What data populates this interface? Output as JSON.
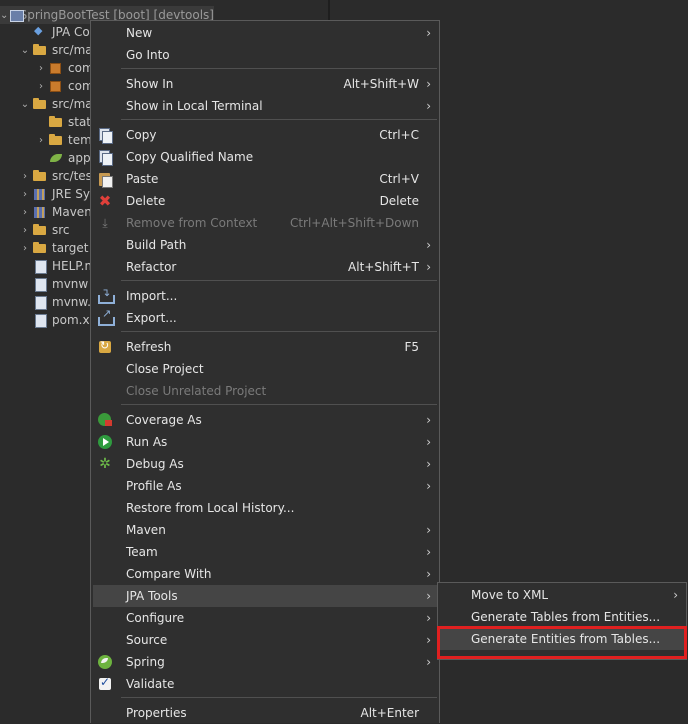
{
  "explorer": {
    "items": [
      {
        "label": "SpringBootTest [boot] [devtools]",
        "icon": "project-icon",
        "chevron": "v"
      },
      {
        "label": "JPA Co",
        "icon": "jpa-content-icon",
        "chevron": ""
      },
      {
        "label": "src/ma",
        "icon": "source-folder-icon",
        "chevron": "v"
      },
      {
        "label": "com",
        "icon": "package-icon",
        "chevron": ">"
      },
      {
        "label": "com",
        "icon": "package-icon",
        "chevron": ">"
      },
      {
        "label": "src/ma",
        "icon": "source-folder-icon",
        "chevron": "v"
      },
      {
        "label": "stati",
        "icon": "folder-icon",
        "chevron": ""
      },
      {
        "label": "tem",
        "icon": "folder-icon",
        "chevron": ">"
      },
      {
        "label": "app",
        "icon": "leaf-icon",
        "chevron": ""
      },
      {
        "label": "src/test",
        "icon": "source-folder-icon",
        "chevron": ">"
      },
      {
        "label": "JRE Sys",
        "icon": "library-icon",
        "chevron": ">"
      },
      {
        "label": "Maven",
        "icon": "library-icon",
        "chevron": ">"
      },
      {
        "label": "src",
        "icon": "folder-icon",
        "chevron": ">"
      },
      {
        "label": "target",
        "icon": "folder-icon",
        "chevron": ">"
      },
      {
        "label": "HELP.m",
        "icon": "file-icon",
        "chevron": ""
      },
      {
        "label": "mvnw",
        "icon": "file-icon",
        "chevron": ""
      },
      {
        "label": "mvnw.",
        "icon": "file-icon",
        "chevron": ""
      },
      {
        "label": "pom.xn",
        "icon": "file-icon",
        "chevron": ""
      }
    ]
  },
  "context_menu": {
    "items": [
      {
        "label": "New",
        "accel": "",
        "submenu": true
      },
      {
        "label": "Go Into",
        "accel": ""
      },
      {
        "label": "Show In",
        "accel": "Alt+Shift+W",
        "submenu": true
      },
      {
        "label": "Show in Local Terminal",
        "accel": "",
        "submenu": true
      },
      {
        "label": "Copy",
        "accel": "Ctrl+C"
      },
      {
        "label": "Copy Qualified Name",
        "accel": ""
      },
      {
        "label": "Paste",
        "accel": "Ctrl+V"
      },
      {
        "label": "Delete",
        "accel": "Delete"
      },
      {
        "label": "Remove from Context",
        "accel": "Ctrl+Alt+Shift+Down",
        "disabled": true
      },
      {
        "label": "Build Path",
        "accel": "",
        "submenu": true
      },
      {
        "label": "Refactor",
        "accel": "Alt+Shift+T",
        "submenu": true
      },
      {
        "label": "Import...",
        "accel": ""
      },
      {
        "label": "Export...",
        "accel": ""
      },
      {
        "label": "Refresh",
        "accel": "F5"
      },
      {
        "label": "Close Project",
        "accel": ""
      },
      {
        "label": "Close Unrelated Project",
        "accel": "",
        "disabled": true
      },
      {
        "label": "Coverage As",
        "accel": "",
        "submenu": true
      },
      {
        "label": "Run As",
        "accel": "",
        "submenu": true
      },
      {
        "label": "Debug As",
        "accel": "",
        "submenu": true
      },
      {
        "label": "Profile As",
        "accel": "",
        "submenu": true
      },
      {
        "label": "Restore from Local History...",
        "accel": ""
      },
      {
        "label": "Maven",
        "accel": "",
        "submenu": true
      },
      {
        "label": "Team",
        "accel": "",
        "submenu": true
      },
      {
        "label": "Compare With",
        "accel": "",
        "submenu": true
      },
      {
        "label": "JPA Tools",
        "accel": "",
        "submenu": true,
        "highlighted": true
      },
      {
        "label": "Configure",
        "accel": "",
        "submenu": true
      },
      {
        "label": "Source",
        "accel": "",
        "submenu": true
      },
      {
        "label": "Spring",
        "accel": "",
        "submenu": true
      },
      {
        "label": "Validate",
        "accel": ""
      },
      {
        "label": "Properties",
        "accel": "Alt+Enter"
      }
    ]
  },
  "jpa_submenu": {
    "items": [
      {
        "label": "Move to XML",
        "submenu": true
      },
      {
        "label": "Generate Tables from Entities..."
      },
      {
        "label": "Generate Entities from Tables...",
        "highlighted": true
      }
    ]
  },
  "colors": {
    "highlight_outline": "#e02020",
    "menu_bg": "#2f2f2f"
  }
}
